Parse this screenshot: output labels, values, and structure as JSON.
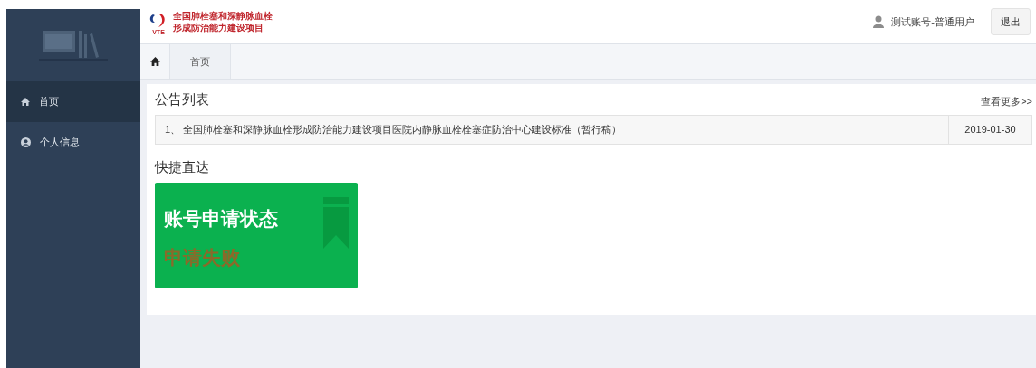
{
  "header": {
    "logo_text": "VTE",
    "project_title": [
      "全国肺栓塞和深静脉血栓",
      "形成防治能力建设项目"
    ],
    "user": "测试账号-普通用户",
    "logout": "退出"
  },
  "sidebar": {
    "items": [
      {
        "label": "首页",
        "kind": "home",
        "selected": true
      },
      {
        "label": "个人信息",
        "kind": "user",
        "selected": false
      }
    ]
  },
  "tabs": [
    {
      "label": "首页",
      "selected": true
    }
  ],
  "notices": {
    "title": "公告列表",
    "more": "查看更多>>",
    "rows": [
      {
        "text": "1、 全国肺栓塞和深静脉血栓形成防治能力建设项目医院内静脉血栓栓塞症防治中心建设标准（暂行稿）",
        "date": "2019-01-30"
      }
    ]
  },
  "shortcuts": {
    "title": "快捷直达",
    "cards": [
      {
        "title": "账号申请状态",
        "status": "申请失败",
        "color": "#8a6a2a"
      }
    ]
  }
}
